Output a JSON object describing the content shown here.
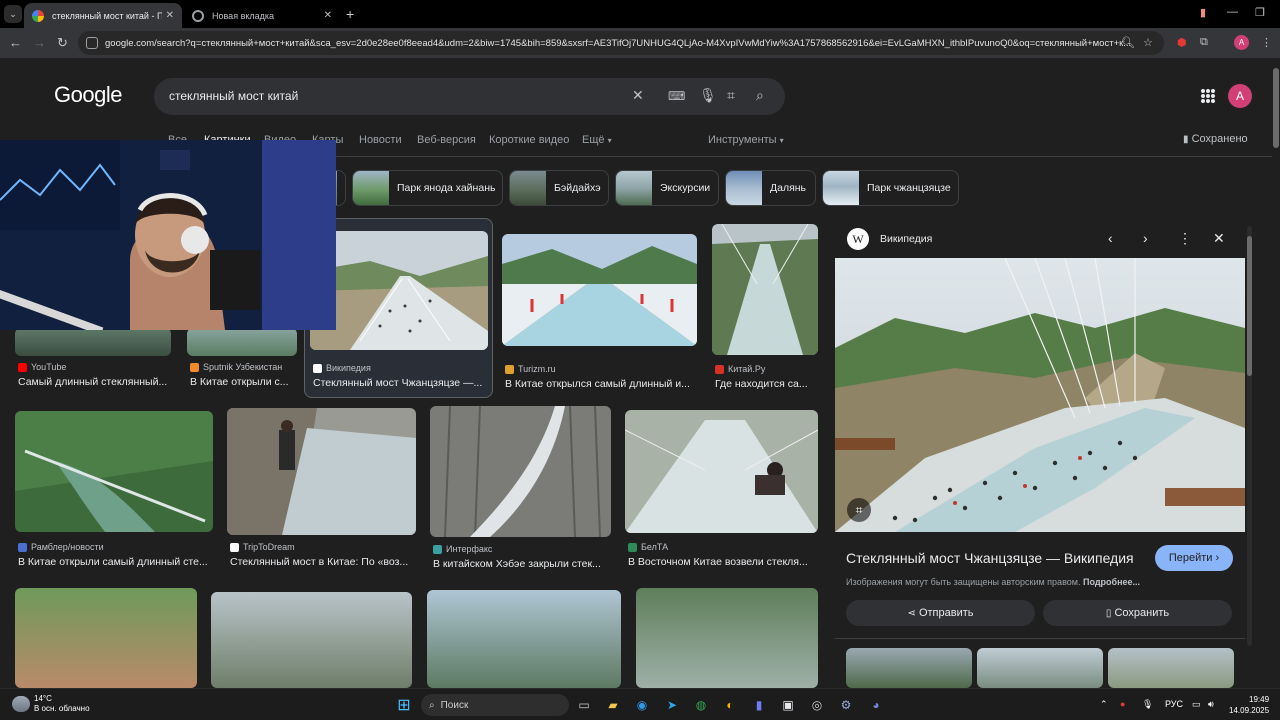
{
  "browser": {
    "tabs": [
      {
        "label": "стеклянный мост китай - Пои",
        "active": true
      },
      {
        "label": "Новая вкладка",
        "active": false
      }
    ],
    "url": "google.com/search?q=стеклянный+мост+китай&sca_esv=2d0e28ee0f8eead4&udm=2&biw=1745&bih=859&sxsrf=AE3TifOj7UNHUG4QLjAo-M4XvpIVwMdYiw%3A1757868562916&ei=EvLGaMHXN_ithbIPuvunoQ0&oq=стеклянный+мост+к...",
    "profile_initial": "A"
  },
  "google": {
    "logo": "Google",
    "query": "стеклянный мост китай",
    "profile_initial": "A",
    "nav": [
      {
        "label": "Все",
        "active": false
      },
      {
        "label": "Картинки",
        "active": true
      },
      {
        "label": "Видео",
        "active": false
      },
      {
        "label": "Карты",
        "active": false
      },
      {
        "label": "Новости",
        "active": false
      },
      {
        "label": "Веб-версия",
        "active": false
      },
      {
        "label": "Короткие видео",
        "active": false
      },
      {
        "label": "Ещё",
        "active": false
      }
    ],
    "tools": "Инструменты",
    "saved": "Сохранено"
  },
  "chips": [
    {
      "label": "Парк янода хайнань"
    },
    {
      "label": "Бэйдайхэ"
    },
    {
      "label": "Экскурсии"
    },
    {
      "label": "Далянь"
    },
    {
      "label": "Парк чжанцзяцзе"
    }
  ],
  "results": [
    {
      "source": "YouTube",
      "title": "Самый длинный стеклянный...",
      "color": "#ff0000"
    },
    {
      "source": "Sputnik Узбекистан",
      "title": "В Китае открыли с...",
      "color": "#f28b30"
    },
    {
      "source": "Википедия",
      "title": "Стеклянный мост Чжанцзяцзе —...",
      "color": "#ffffff"
    },
    {
      "source": "Turizm.ru",
      "title": "В Китае открылся самый длинный и...",
      "color": "#e0a030"
    },
    {
      "source": "Китай.Ру",
      "title": "Где находится са...",
      "color": "#d93025"
    },
    {
      "source": "Рамблер/новости",
      "title": "В Китае открыли самый длинный сте...",
      "color": "#4a6fd1"
    },
    {
      "source": "TripToDream",
      "title": "Стеклянный мост в Китае: По «воз...",
      "color": "#ffffff"
    },
    {
      "source": "Интерфакс",
      "title": "В китайском Хэбэе закрыли стек...",
      "color": "#3aa0a0"
    },
    {
      "source": "БелТА",
      "title": "В Восточном Китае возвели стекля...",
      "color": "#2e8b57"
    }
  ],
  "panel": {
    "site": "Википедия",
    "title": "Стеклянный мост Чжанцзяцзе — Википедия",
    "visit": "Перейти",
    "copyright": "Изображения могут быть защищены авторским правом.",
    "more": "Подробнее...",
    "share": "Отправить",
    "save": "Сохранить"
  },
  "taskbar": {
    "temp": "14°C",
    "weather": "В осн. облачно",
    "search": "Поиск",
    "lang": "РУС",
    "time": "19:49",
    "date": "14.09.2025"
  }
}
